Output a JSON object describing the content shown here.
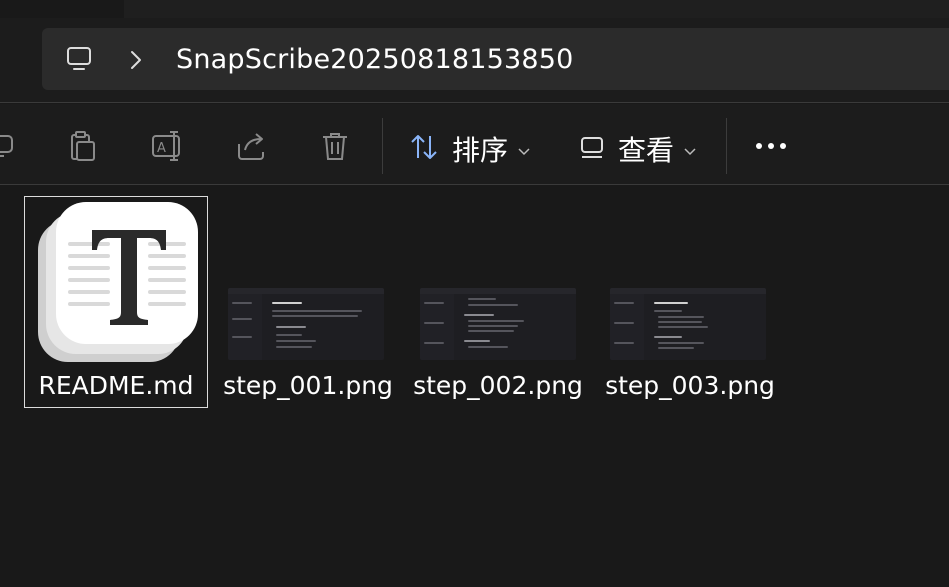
{
  "address": {
    "path_icon": "computer-monitor-icon",
    "separator_icon": "chevron-right-icon",
    "folder": "SnapScribe20250818153850"
  },
  "toolbar": {
    "buttons": [
      {
        "name": "share-icon",
        "action": "partial"
      },
      {
        "name": "copy-icon"
      },
      {
        "name": "rename-icon"
      },
      {
        "name": "share-icon"
      },
      {
        "name": "delete-icon"
      }
    ],
    "sort_label": "排序",
    "sort_icon": "sort-arrows-icon",
    "view_label": "查看",
    "view_icon": "view-layout-icon",
    "more_icon": "more-ellipsis-icon"
  },
  "files": [
    {
      "name": "README.md",
      "type": "typora-document",
      "selected": true
    },
    {
      "name": "step_001.png",
      "type": "image"
    },
    {
      "name": "step_002.png",
      "type": "image"
    },
    {
      "name": "step_003.png",
      "type": "image"
    }
  ],
  "colors": {
    "background": "#191919",
    "address_bar": "#2b2b2b",
    "toolbar_icon": "#8a8a8a",
    "text": "#ffffff"
  }
}
